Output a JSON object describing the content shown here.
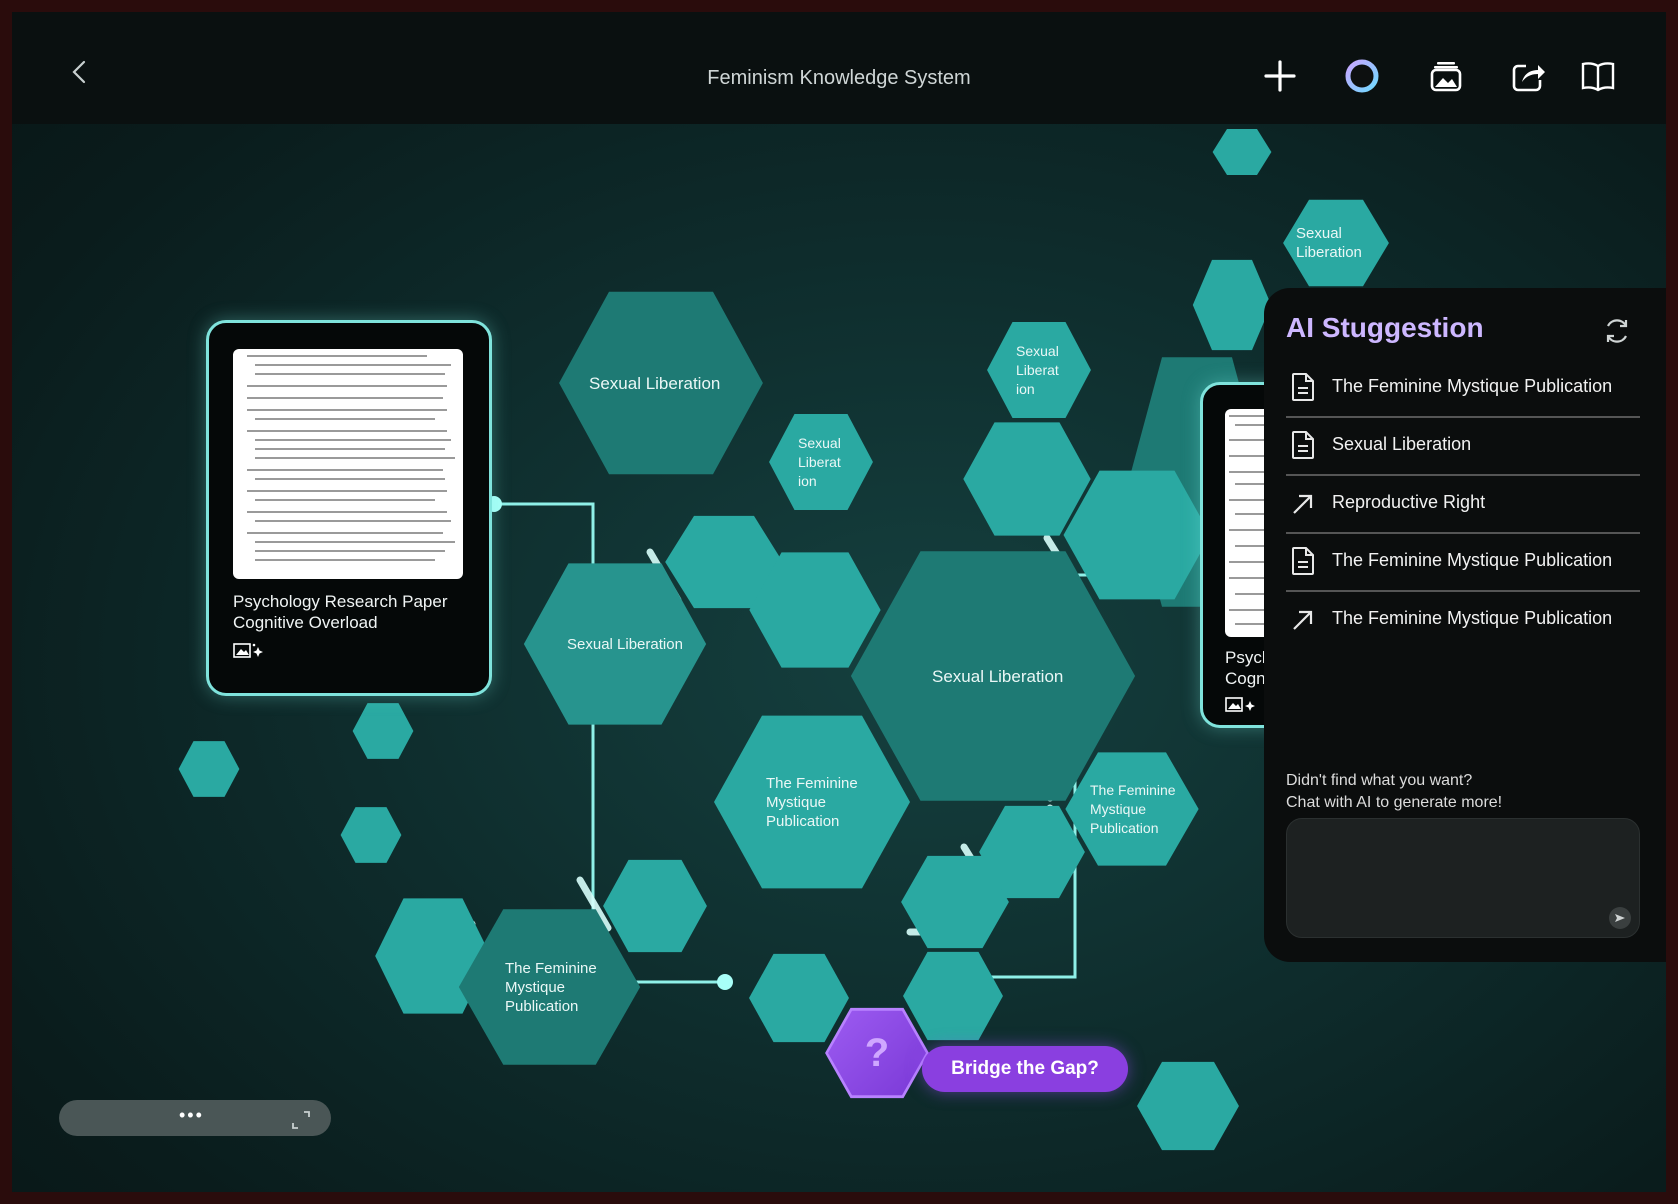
{
  "app": {
    "title": "Feminism Knowledge System"
  },
  "nodes": {
    "n1": "Sexual Liberation",
    "n2": "Sexual Liberation",
    "n3": "Sexual\nLiberat\nion",
    "n4": "Sexual\nLiberat\nion",
    "n5": "Sexual Liberation",
    "n6": "Sexual Liberation",
    "n7": "The Feminine\nMystique\nPublication",
    "n8": "The Feminine\nMystique\nPublication",
    "n9": "The Feminine\nMystique\nPublication",
    "q": "?"
  },
  "cards": {
    "left": {
      "title_line1": "Psychology Research Paper",
      "title_line2": "Cognitive Overload"
    },
    "right": {
      "title_line1": "Psycl",
      "title_line2": "Cogn"
    }
  },
  "panel": {
    "title": "AI Stuggestion",
    "suggestions": [
      {
        "label": "The Feminine Mystique Publication",
        "icon": "document-icon"
      },
      {
        "label": "Sexual Liberation",
        "icon": "document-icon"
      },
      {
        "label": "Reproductive Right",
        "icon": "arrow-up-right-icon"
      },
      {
        "label": "The Feminine Mystique Publication",
        "icon": "document-icon"
      },
      {
        "label": "The Feminine Mystique Publication",
        "icon": "arrow-up-right-icon"
      }
    ],
    "hint_line1": "Didn't find what you want?",
    "hint_line2": "Chat with AI to generate more!",
    "chat_placeholder": ""
  },
  "actions": {
    "bridge_label": "Bridge the Gap?",
    "more_label": "•••"
  },
  "colors": {
    "accent_teal": "#2aa9a2",
    "accent_purple": "#8a3fe0",
    "panel_title": "#cdb7ff"
  }
}
